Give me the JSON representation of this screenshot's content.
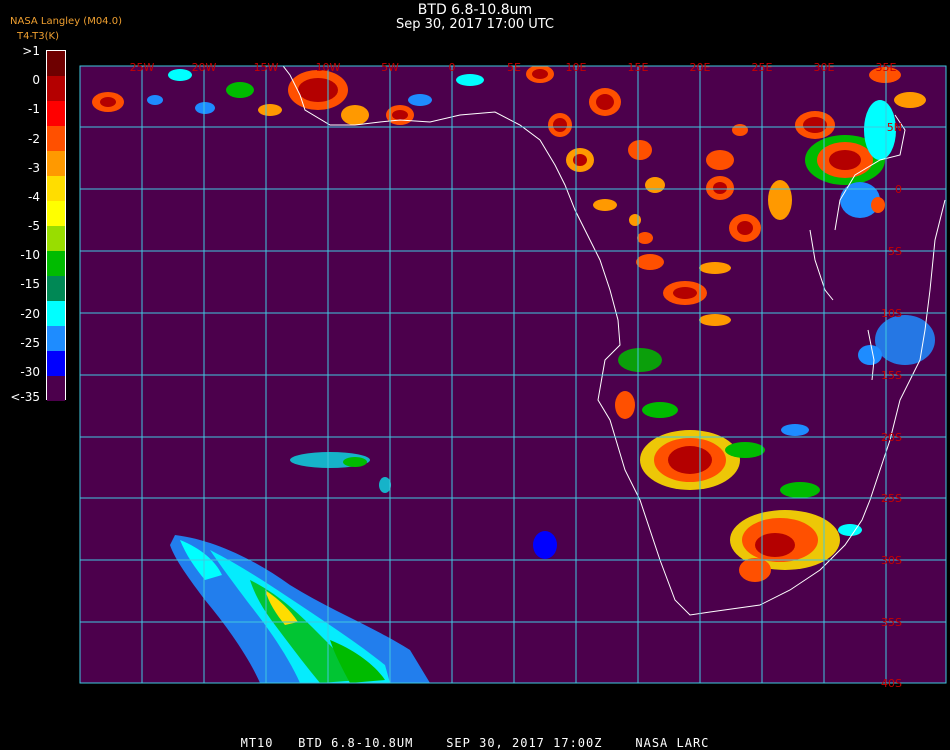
{
  "header": {
    "title": "BTD 6.8-10.8um",
    "datetime": "Sep 30, 2017 17:00 UTC",
    "credit": "NASA Langley (M04.0)",
    "units": "T4-T3(K)"
  },
  "colorbar": {
    "labels": [
      ">1",
      "0",
      "-1",
      "-2",
      "-3",
      "-4",
      "-5",
      "-10",
      "-15",
      "-20",
      "-25",
      "-30",
      "<-35"
    ],
    "colors": [
      "#6e0000",
      "#b40000",
      "#ff0000",
      "#ff5000",
      "#ff9900",
      "#ffdd00",
      "#ffff00",
      "#99dd00",
      "#00bb00",
      "#008855",
      "#00ffff",
      "#1e8cff",
      "#0000ff",
      "#4c004c"
    ]
  },
  "map": {
    "background_color": "#4c004c",
    "grid_color": "#40c8e0",
    "coastline_color": "#ffffff",
    "label_color": "#c80000",
    "lon_labels": [
      "25W",
      "20W",
      "15W",
      "10W",
      "5W",
      "0",
      "5E",
      "10E",
      "15E",
      "20E",
      "25E",
      "30E",
      "35E"
    ],
    "lat_labels": [
      "5N",
      "0",
      "5S",
      "10S",
      "15S",
      "20S",
      "25S",
      "30S",
      "35S",
      "40S"
    ]
  },
  "footer": {
    "text": "MT10   BTD 6.8-10.8UM    SEP 30, 2017 17:00Z    NASA LARC"
  }
}
